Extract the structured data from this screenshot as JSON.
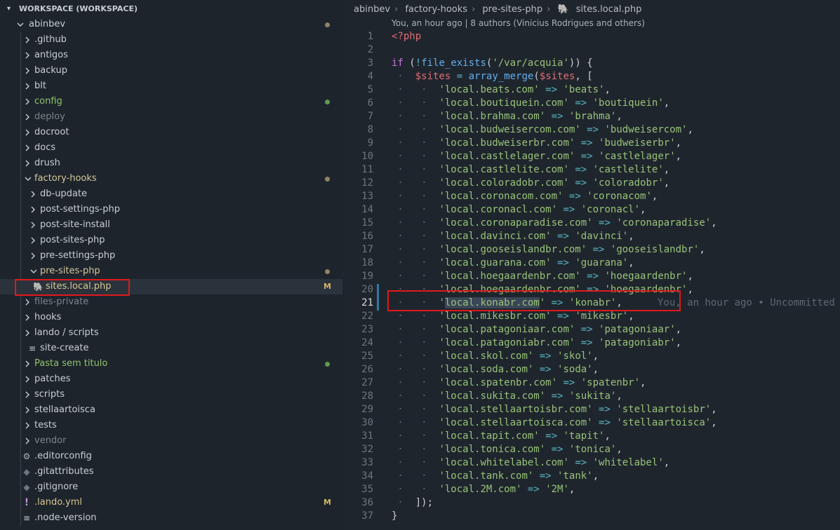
{
  "sidebar": {
    "workspace_title": "WORKSPACE (WORKSPACE)",
    "tree": [
      {
        "label": "abinbev",
        "depth": 0,
        "type": "folder-open",
        "status": "modified"
      },
      {
        "label": ".github",
        "depth": 1,
        "type": "folder"
      },
      {
        "label": "antigos",
        "depth": 1,
        "type": "folder"
      },
      {
        "label": "backup",
        "depth": 1,
        "type": "folder"
      },
      {
        "label": "blt",
        "depth": 1,
        "type": "folder"
      },
      {
        "label": "config",
        "depth": 1,
        "type": "folder",
        "status": "untracked"
      },
      {
        "label": "deploy",
        "depth": 1,
        "type": "folder",
        "status": "ignored"
      },
      {
        "label": "docroot",
        "depth": 1,
        "type": "folder"
      },
      {
        "label": "docs",
        "depth": 1,
        "type": "folder"
      },
      {
        "label": "drush",
        "depth": 1,
        "type": "folder"
      },
      {
        "label": "factory-hooks",
        "depth": 1,
        "type": "folder-open",
        "status": "modified"
      },
      {
        "label": "db-update",
        "depth": 2,
        "type": "folder"
      },
      {
        "label": "post-settings-php",
        "depth": 2,
        "type": "folder"
      },
      {
        "label": "post-site-install",
        "depth": 2,
        "type": "folder"
      },
      {
        "label": "post-sites-php",
        "depth": 2,
        "type": "folder"
      },
      {
        "label": "pre-settings-php",
        "depth": 2,
        "type": "folder"
      },
      {
        "label": "pre-sites-php",
        "depth": 2,
        "type": "folder-open",
        "status": "modified"
      },
      {
        "label": "sites.local.php",
        "depth": 3,
        "type": "file-php",
        "status": "M",
        "selected": true
      },
      {
        "label": "files-private",
        "depth": 1,
        "type": "folder",
        "status": "ignored"
      },
      {
        "label": "hooks",
        "depth": 1,
        "type": "folder"
      },
      {
        "label": "lando / scripts",
        "depth": 1,
        "type": "folder"
      },
      {
        "label": "site-create",
        "depth": 2,
        "type": "file-text"
      },
      {
        "label": "Pasta sem titulo",
        "depth": 1,
        "type": "folder",
        "status": "untracked"
      },
      {
        "label": "patches",
        "depth": 1,
        "type": "folder"
      },
      {
        "label": "scripts",
        "depth": 1,
        "type": "folder"
      },
      {
        "label": "stellaartoisca",
        "depth": 1,
        "type": "folder"
      },
      {
        "label": "tests",
        "depth": 1,
        "type": "folder"
      },
      {
        "label": "vendor",
        "depth": 1,
        "type": "folder",
        "status": "ignored"
      },
      {
        "label": ".editorconfig",
        "depth": 1,
        "type": "file-gear"
      },
      {
        "label": ".gitattributes",
        "depth": 1,
        "type": "file-git"
      },
      {
        "label": ".gitignore",
        "depth": 1,
        "type": "file-git"
      },
      {
        "label": ".lando.yml",
        "depth": 1,
        "type": "file-yml",
        "status": "M"
      },
      {
        "label": ".node-version",
        "depth": 1,
        "type": "file-text"
      }
    ]
  },
  "editor": {
    "breadcrumb": [
      "abinbev",
      "factory-hooks",
      "pre-sites-php",
      "sites.local.php"
    ],
    "blame_header": "You, an hour ago | 8 authors (Vinicius Rodrigues and others)",
    "inline_blame": "You, an hour ago • Uncommitted",
    "current_line": 21,
    "lines": [
      {
        "n": "1",
        "t": "<?php"
      },
      {
        "n": "2",
        "t": ""
      },
      {
        "n": "3",
        "t": "if (!file_exists('/var/acquia')) {"
      },
      {
        "n": "4",
        "t": "    $sites = array_merge($sites, ["
      },
      {
        "n": "5",
        "t": "        'local.beats.com' => 'beats',"
      },
      {
        "n": "6",
        "t": "        'local.boutiquein.com' => 'boutiquein',"
      },
      {
        "n": "7",
        "t": "        'local.brahma.com' => 'brahma',"
      },
      {
        "n": "8",
        "t": "        'local.budweisercom.com' => 'budweisercom',"
      },
      {
        "n": "9",
        "t": "        'local.budweiserbr.com' => 'budweiserbr',"
      },
      {
        "n": "10",
        "t": "        'local.castlelager.com' => 'castlelager',"
      },
      {
        "n": "11",
        "t": "        'local.castlelite.com' => 'castlelite',"
      },
      {
        "n": "12",
        "t": "        'local.coloradobr.com' => 'coloradobr',"
      },
      {
        "n": "13",
        "t": "        'local.coronacom.com' => 'coronacom',"
      },
      {
        "n": "14",
        "t": "        'local.coronacl.com' => 'coronacl',"
      },
      {
        "n": "15",
        "t": "        'local.coronaparadise.com' => 'coronaparadise',"
      },
      {
        "n": "16",
        "t": "        'local.davinci.com' => 'davinci',"
      },
      {
        "n": "17",
        "t": "        'local.gooseislandbr.com' => 'gooseislandbr',"
      },
      {
        "n": "18",
        "t": "        'local.guarana.com' => 'guarana',"
      },
      {
        "n": "19",
        "t": "        'local.hoegaardenbr.com' => 'hoegaardenbr',"
      },
      {
        "n": "20",
        "t": "        'local.hoegaardenbr.com' => 'hoegaardenbr',"
      },
      {
        "n": "21",
        "t": "        'local.konabr.com' => 'konabr',"
      },
      {
        "n": "22",
        "t": "        'local.mikesbr.com' => 'mikesbr',"
      },
      {
        "n": "23",
        "t": "        'local.patagoniaar.com' => 'patagoniaar',"
      },
      {
        "n": "24",
        "t": "        'local.patagoniabr.com' => 'patagoniabr',"
      },
      {
        "n": "25",
        "t": "        'local.skol.com' => 'skol',"
      },
      {
        "n": "26",
        "t": "        'local.soda.com' => 'soda',"
      },
      {
        "n": "27",
        "t": "        'local.spatenbr.com' => 'spatenbr',"
      },
      {
        "n": "28",
        "t": "        'local.sukita.com' => 'sukita',"
      },
      {
        "n": "29",
        "t": "        'local.stellaartoisbr.com' => 'stellaartoisbr',"
      },
      {
        "n": "30",
        "t": "        'local.stellaartoisca.com' => 'stellaartoisca',"
      },
      {
        "n": "31",
        "t": "        'local.tapit.com' => 'tapit',"
      },
      {
        "n": "32",
        "t": "        'local.tonica.com' => 'tonica',"
      },
      {
        "n": "33",
        "t": "        'local.whitelabel.com' => 'whitelabel',"
      },
      {
        "n": "34",
        "t": "        'local.tank.com' => 'tank',"
      },
      {
        "n": "35",
        "t": "        'local.2M.com' => '2M',"
      },
      {
        "n": "36",
        "t": "    ]);"
      },
      {
        "n": "37",
        "t": "}"
      }
    ]
  },
  "colors": {
    "modified_dot": "#8f8566",
    "untracked_dot": "#5f9a4e",
    "badge_M": "#d1b46a",
    "ignored_text": "#7d848b",
    "untracked_text": "#8fc46a",
    "highlight_box": "#e0191c"
  }
}
